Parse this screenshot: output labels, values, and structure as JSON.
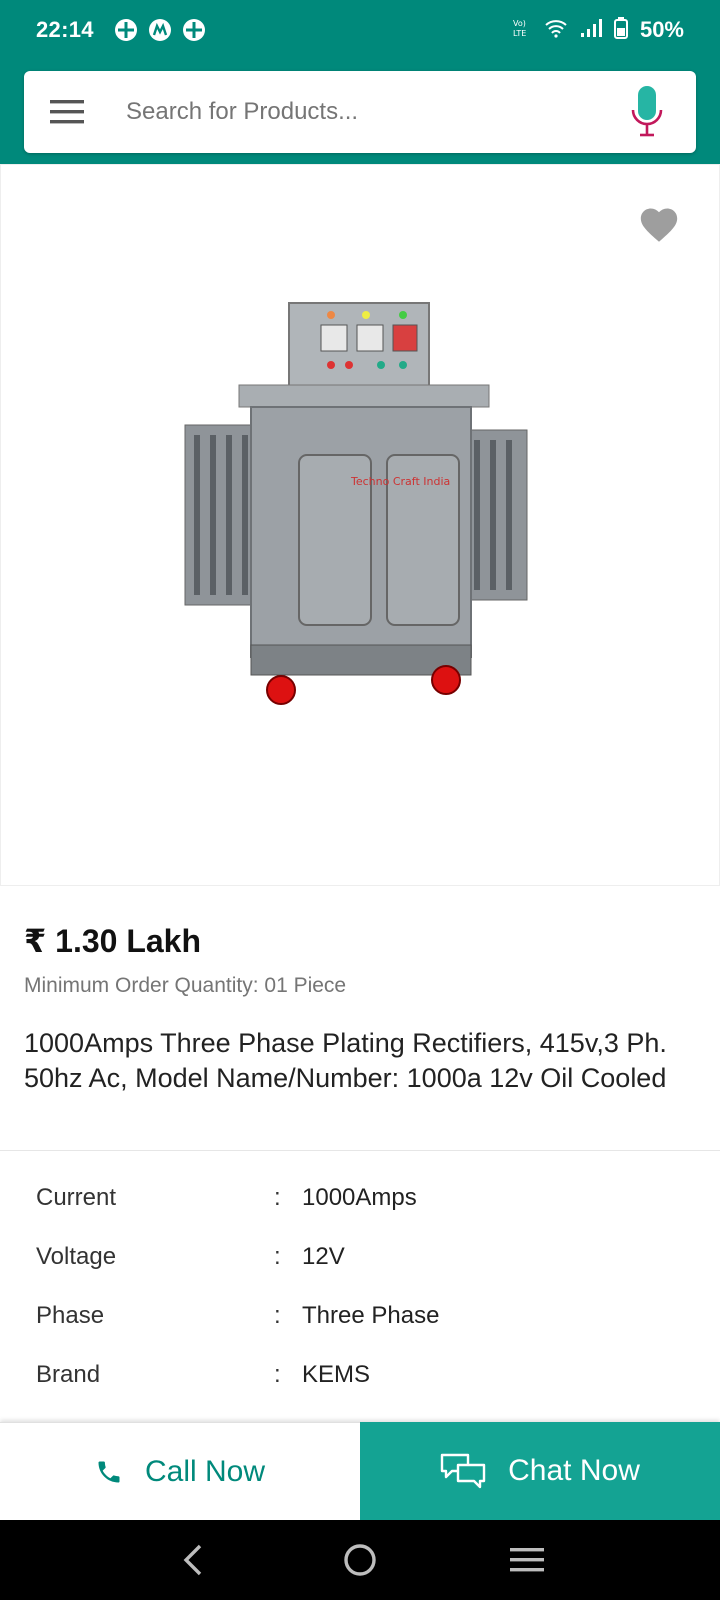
{
  "status_bar": {
    "time": "22:14",
    "battery": "50%",
    "network_label": "Vo) LTE"
  },
  "search": {
    "placeholder": "Search for Products..."
  },
  "product": {
    "price": "₹ 1.30 Lakh",
    "moq": "Minimum Order Quantity: 01 Piece",
    "title": "1000Amps Three Phase Plating Rectifiers, 415v,3 Ph. 50hz Ac, Model Name/Number: 1000a 12v Oil Cooled",
    "image_watermark": "Techno Craft India",
    "specs": [
      {
        "key": "Current",
        "value": "1000Amps"
      },
      {
        "key": "Voltage",
        "value": "12V"
      },
      {
        "key": "Phase",
        "value": "Three Phase"
      },
      {
        "key": "Brand",
        "value": "KEMS"
      }
    ]
  },
  "actions": {
    "call_label": "Call Now",
    "chat_label": "Chat Now"
  },
  "colors": {
    "brand": "#00897b",
    "chat_bg": "#14a393",
    "mic": "#c2185b"
  },
  "icons": [
    "menu-icon",
    "mic-icon",
    "heart-icon",
    "phone-icon",
    "chat-icon",
    "back-icon",
    "home-icon",
    "recents-icon"
  ]
}
